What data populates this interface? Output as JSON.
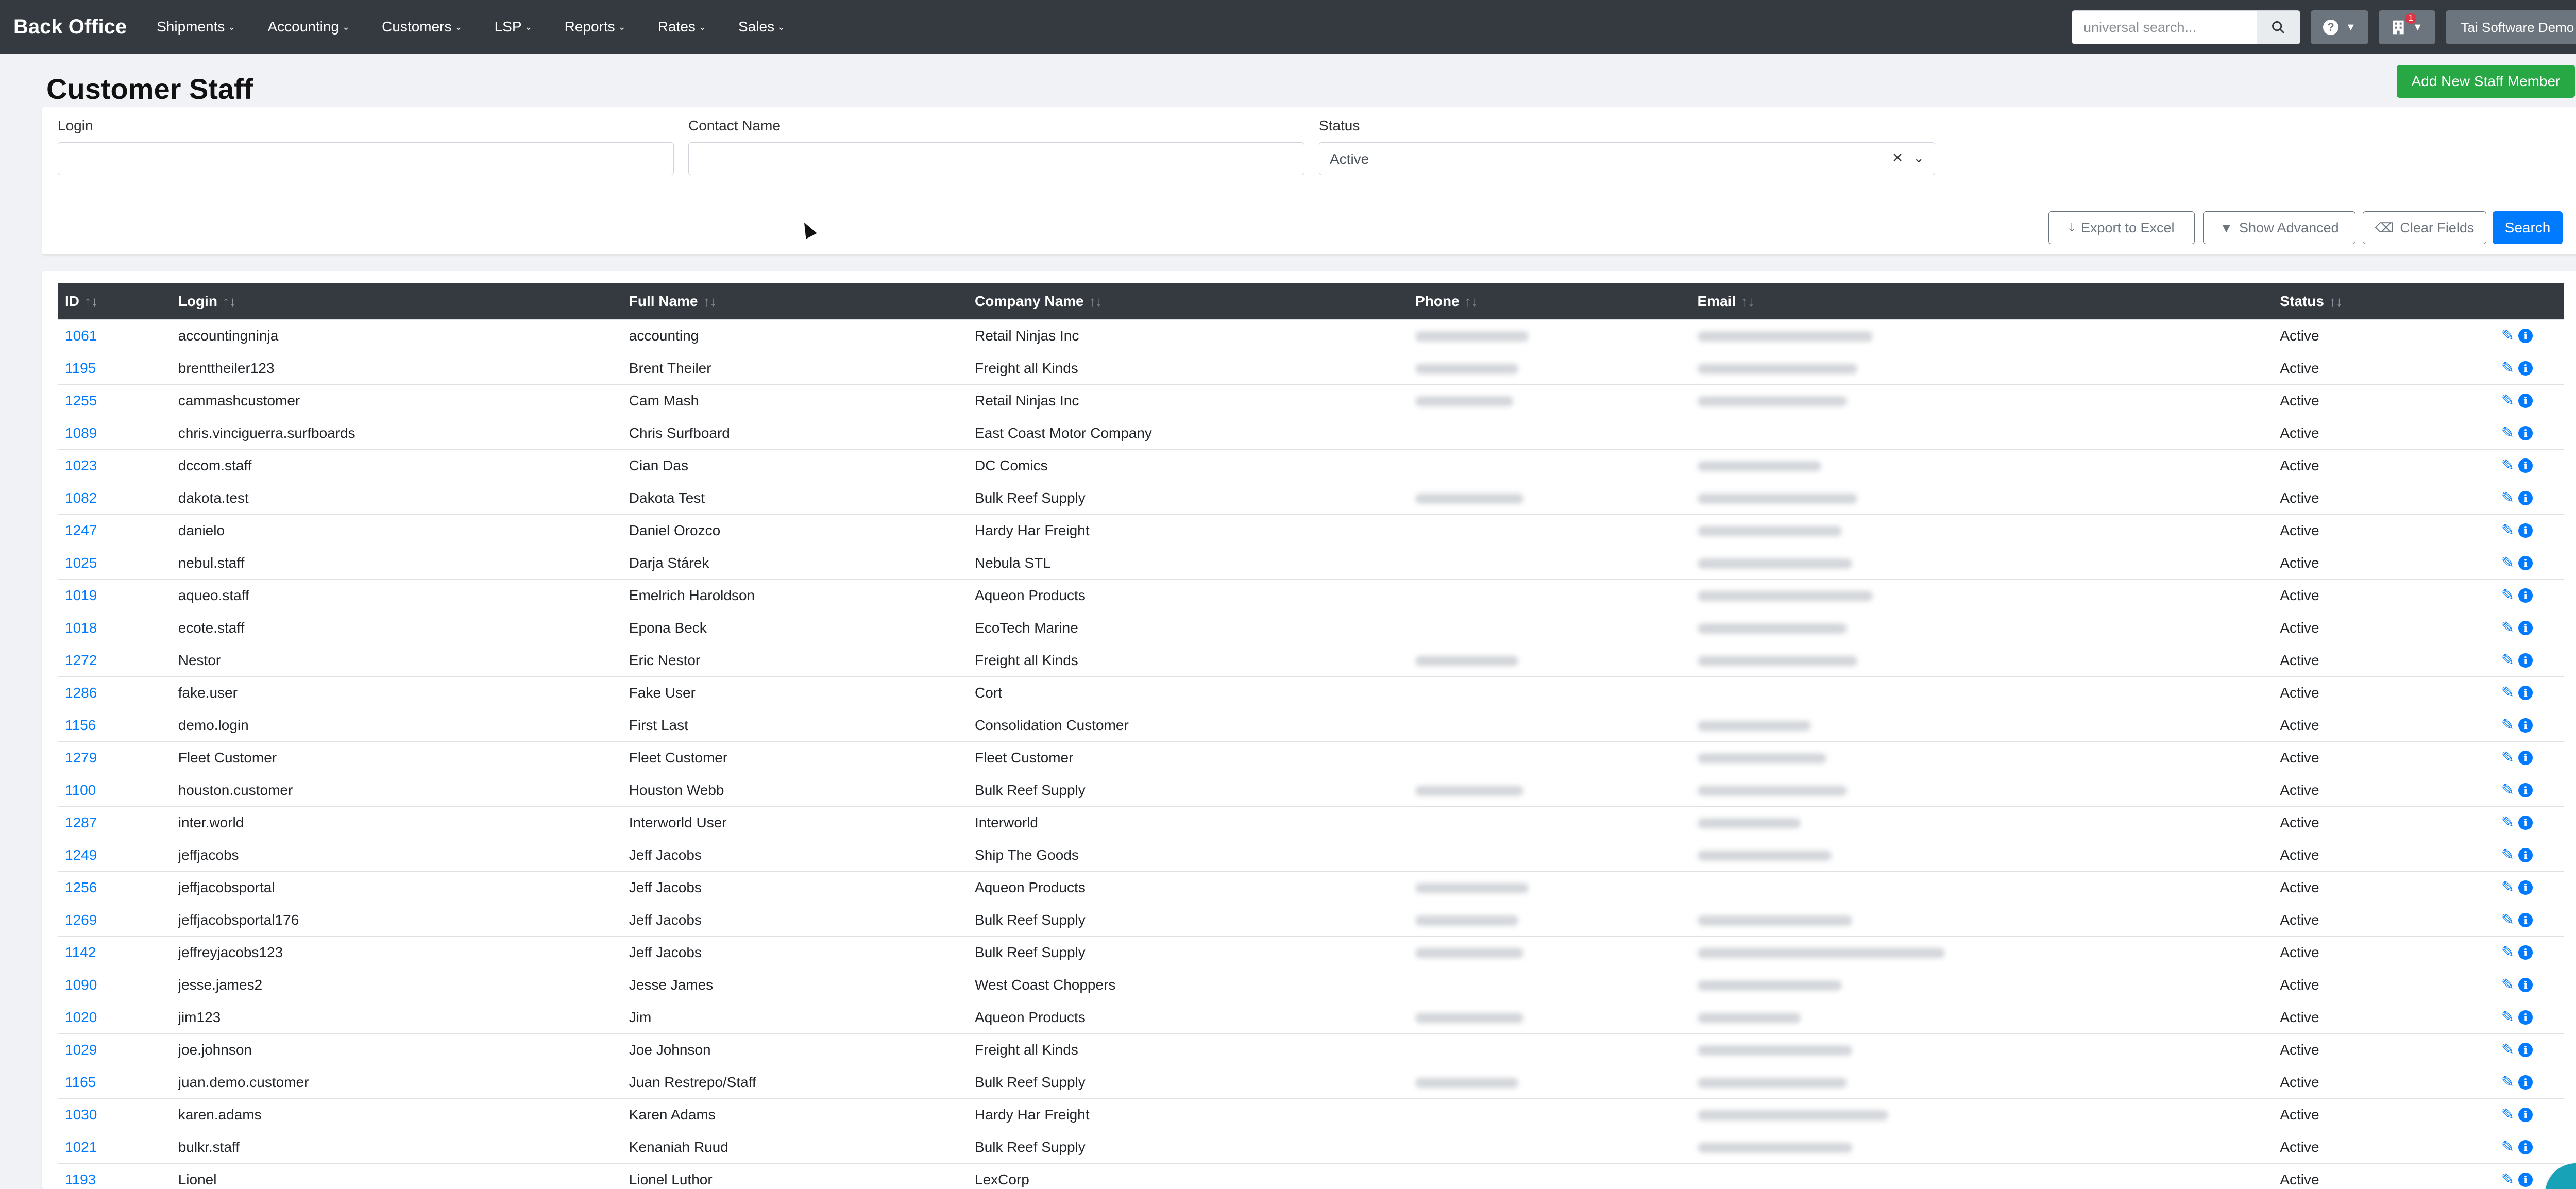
{
  "navbar": {
    "brand": "Back Office",
    "menu": [
      "Shipments",
      "Accounting",
      "Customers",
      "LSP",
      "Reports",
      "Rates",
      "Sales"
    ],
    "search_placeholder": "universal search...",
    "notification_count": "1",
    "tenant": "Tai Software Demo"
  },
  "page": {
    "title": "Customer Staff",
    "add_button": "Add New Staff Member"
  },
  "filters": {
    "login_label": "Login",
    "login_value": "",
    "contact_label": "Contact Name",
    "contact_value": "",
    "status_label": "Status",
    "status_value": "Active",
    "buttons": {
      "export": "Export to Excel",
      "advanced": "Show Advanced",
      "clear": "Clear Fields",
      "search": "Search"
    }
  },
  "table": {
    "columns": [
      "ID",
      "Login",
      "Full Name",
      "Company Name",
      "Phone",
      "Email",
      "Status"
    ],
    "rows": [
      {
        "id": "1061",
        "login": "accountingninja",
        "name": "accounting",
        "company": "Retail Ninjas Inc",
        "phone": true,
        "email": true,
        "status": "Active"
      },
      {
        "id": "1195",
        "login": "brenttheiler123",
        "name": "Brent Theiler",
        "company": "Freight all Kinds",
        "phone": true,
        "email": true,
        "status": "Active"
      },
      {
        "id": "1255",
        "login": "cammashcustomer",
        "name": "Cam Mash",
        "company": "Retail Ninjas Inc",
        "phone": true,
        "email": true,
        "status": "Active"
      },
      {
        "id": "1089",
        "login": "chris.vinciguerra.surfboards",
        "name": "Chris Surfboard",
        "company": "East Coast Motor Company",
        "phone": false,
        "email": false,
        "status": "Active"
      },
      {
        "id": "1023",
        "login": "dccom.staff",
        "name": "Cian Das",
        "company": "DC Comics",
        "phone": false,
        "email": true,
        "status": "Active"
      },
      {
        "id": "1082",
        "login": "dakota.test",
        "name": "Dakota Test",
        "company": "Bulk Reef Supply",
        "phone": true,
        "email": true,
        "status": "Active"
      },
      {
        "id": "1247",
        "login": "danielo",
        "name": "Daniel Orozco",
        "company": "Hardy Har Freight",
        "phone": false,
        "email": true,
        "status": "Active"
      },
      {
        "id": "1025",
        "login": "nebul.staff",
        "name": "Darja Stárek",
        "company": "Nebula STL",
        "phone": false,
        "email": true,
        "status": "Active"
      },
      {
        "id": "1019",
        "login": "aqueo.staff",
        "name": "Emelrich Haroldson",
        "company": "Aqueon Products",
        "phone": false,
        "email": true,
        "status": "Active"
      },
      {
        "id": "1018",
        "login": "ecote.staff",
        "name": "Epona Beck",
        "company": "EcoTech Marine",
        "phone": false,
        "email": true,
        "status": "Active"
      },
      {
        "id": "1272",
        "login": "Nestor",
        "name": "Eric Nestor",
        "company": "Freight all Kinds",
        "phone": true,
        "email": true,
        "status": "Active"
      },
      {
        "id": "1286",
        "login": "fake.user",
        "name": "Fake User",
        "company": "Cort",
        "phone": false,
        "email": false,
        "status": "Active"
      },
      {
        "id": "1156",
        "login": "demo.login",
        "name": "First Last",
        "company": "Consolidation Customer",
        "phone": false,
        "email": true,
        "status": "Active"
      },
      {
        "id": "1279",
        "login": "Fleet Customer",
        "name": "Fleet Customer",
        "company": "Fleet Customer",
        "phone": false,
        "email": true,
        "status": "Active"
      },
      {
        "id": "1100",
        "login": "houston.customer",
        "name": "Houston Webb",
        "company": "Bulk Reef Supply",
        "phone": true,
        "email": true,
        "status": "Active"
      },
      {
        "id": "1287",
        "login": "inter.world",
        "name": "Interworld User",
        "company": "Interworld",
        "phone": false,
        "email": true,
        "status": "Active"
      },
      {
        "id": "1249",
        "login": "jeffjacobs",
        "name": "Jeff Jacobs",
        "company": "Ship The Goods",
        "phone": false,
        "email": true,
        "status": "Active"
      },
      {
        "id": "1256",
        "login": "jeffjacobsportal",
        "name": "Jeff Jacobs",
        "company": "Aqueon Products",
        "phone": true,
        "email": false,
        "status": "Active"
      },
      {
        "id": "1269",
        "login": "jeffjacobsportal176",
        "name": "Jeff Jacobs",
        "company": "Bulk Reef Supply",
        "phone": true,
        "email": true,
        "status": "Active"
      },
      {
        "id": "1142",
        "login": "jeffreyjacobs123",
        "name": "Jeff Jacobs",
        "company": "Bulk Reef Supply",
        "phone": true,
        "email": true,
        "status": "Active"
      },
      {
        "id": "1090",
        "login": "jesse.james2",
        "name": "Jesse James",
        "company": "West Coast Choppers",
        "phone": false,
        "email": true,
        "status": "Active"
      },
      {
        "id": "1020",
        "login": "jim123",
        "name": "Jim",
        "company": "Aqueon Products",
        "phone": true,
        "email": true,
        "status": "Active"
      },
      {
        "id": "1029",
        "login": "joe.johnson",
        "name": "Joe Johnson",
        "company": "Freight all Kinds",
        "phone": false,
        "email": true,
        "status": "Active"
      },
      {
        "id": "1165",
        "login": "juan.demo.customer",
        "name": "Juan Restrepo/Staff",
        "company": "Bulk Reef Supply",
        "phone": true,
        "email": true,
        "status": "Active"
      },
      {
        "id": "1030",
        "login": "karen.adams",
        "name": "Karen Adams",
        "company": "Hardy Har Freight",
        "phone": false,
        "email": true,
        "status": "Active"
      },
      {
        "id": "1021",
        "login": "bulkr.staff",
        "name": "Kenaniah Ruud",
        "company": "Bulk Reef Supply",
        "phone": false,
        "email": true,
        "status": "Active"
      },
      {
        "id": "1193",
        "login": "Lionel",
        "name": "Lionel Luthor",
        "company": "LexCorp",
        "phone": false,
        "email": false,
        "status": "Active"
      }
    ]
  },
  "colors": {
    "navbar": "#343a40",
    "primary": "#007bff",
    "success": "#28a745"
  }
}
